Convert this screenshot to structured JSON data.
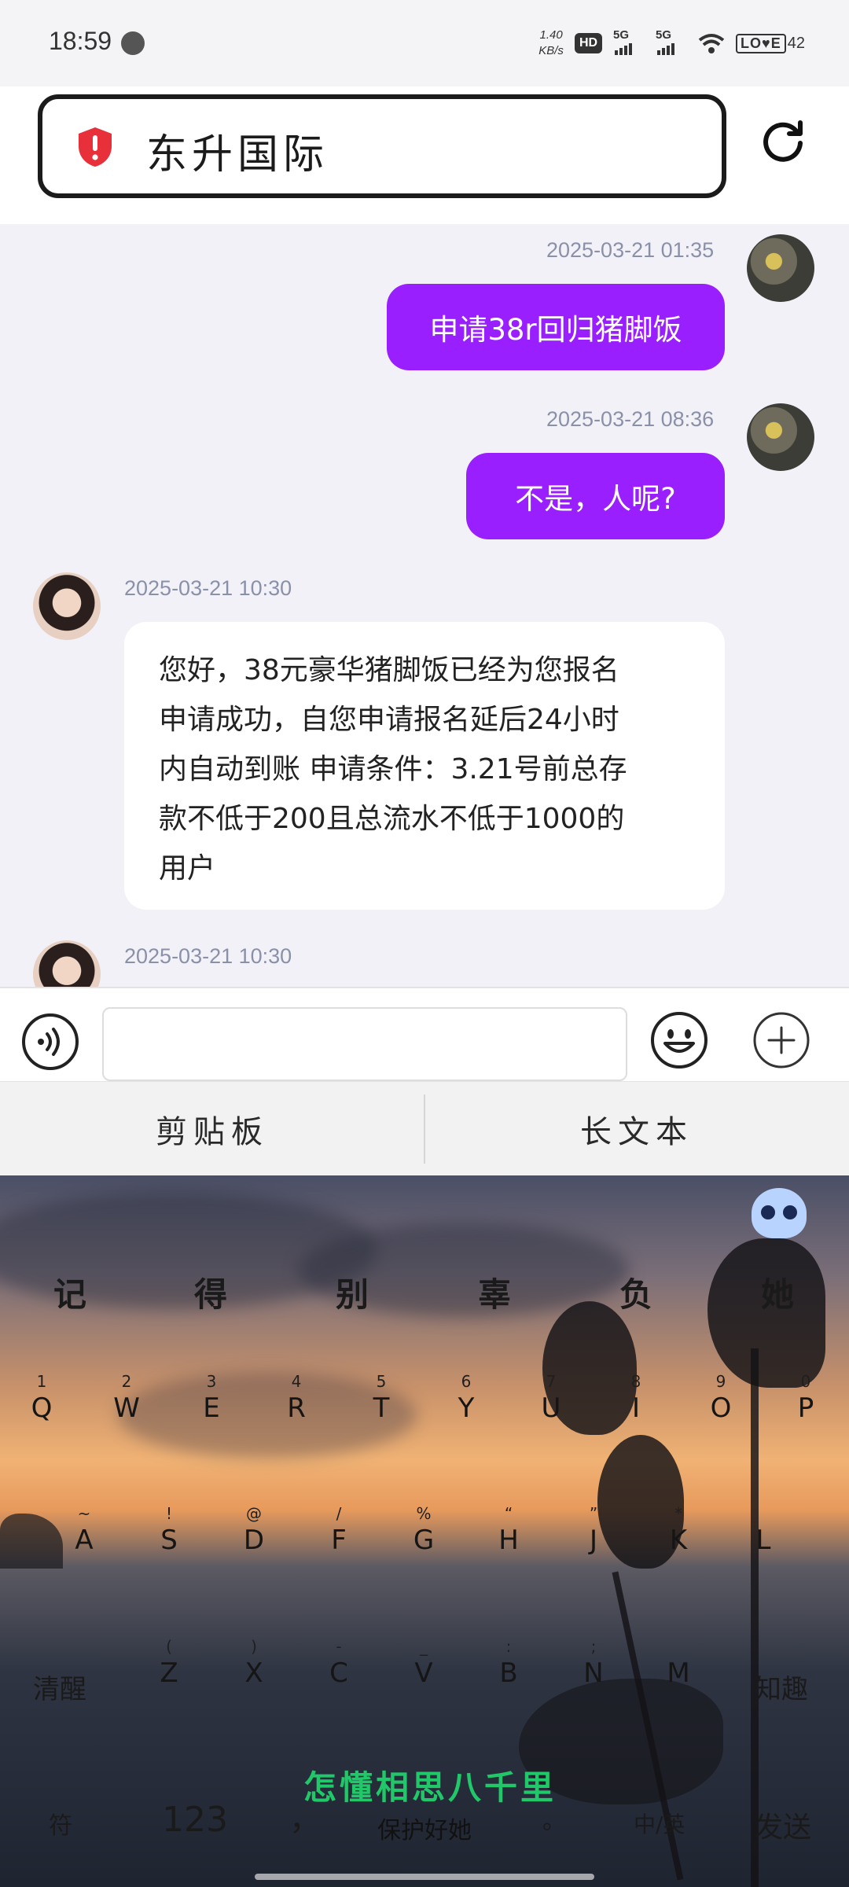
{
  "status_bar": {
    "time": "18:59",
    "net_speed_value": "1.40",
    "net_speed_unit": "KB/s",
    "hd_label": "HD",
    "sim1_label": "5G",
    "sim2_label": "5G",
    "battery_label": "LO♥E",
    "battery_level": "42"
  },
  "header": {
    "title": "东升国际",
    "shield_color": "#e8303a"
  },
  "messages": [
    {
      "sender": "self",
      "timestamp": "2025-03-21 01:35",
      "text": "申请38r回归猪脚饭"
    },
    {
      "sender": "self",
      "timestamp": "2025-03-21 08:36",
      "text": "不是，人呢?"
    },
    {
      "sender": "agent",
      "timestamp": "2025-03-21 10:30",
      "lines": [
        "您好，38元豪华猪脚饭已经为您报名",
        "申请成功，自您申请报名延后24小时",
        "内自动到账 申请条件：3.21号前总存",
        "款不低于200且总流水不低于1000的",
        "用户"
      ]
    },
    {
      "sender": "agent",
      "timestamp": "2025-03-21 10:30"
    }
  ],
  "input_bar": {
    "placeholder": ""
  },
  "keyboard_toolbar": {
    "clipboard": "剪贴板",
    "long_text": "长文本"
  },
  "keyboard": {
    "candidates": [
      "记",
      "得",
      "别",
      "辜",
      "负",
      "她"
    ],
    "row1": [
      {
        "top": "1",
        "main": "Q"
      },
      {
        "top": "2",
        "main": "W"
      },
      {
        "top": "3",
        "main": "E"
      },
      {
        "top": "4",
        "main": "R"
      },
      {
        "top": "5",
        "main": "T"
      },
      {
        "top": "6",
        "main": "Y"
      },
      {
        "top": "7",
        "main": "U"
      },
      {
        "top": "8",
        "main": "I"
      },
      {
        "top": "9",
        "main": "O"
      },
      {
        "top": "0",
        "main": "P"
      }
    ],
    "row2": [
      {
        "top": "~",
        "main": "A"
      },
      {
        "top": "!",
        "main": "S"
      },
      {
        "top": "@",
        "main": "D"
      },
      {
        "top": "/",
        "main": "F"
      },
      {
        "top": "%",
        "main": "G"
      },
      {
        "top": "“",
        "main": "H"
      },
      {
        "top": "”",
        "main": "J"
      },
      {
        "top": "*",
        "main": "K"
      },
      {
        "top": "",
        "main": "L"
      }
    ],
    "row3": [
      {
        "top": "(",
        "main": "Z"
      },
      {
        "top": ")",
        "main": "X"
      },
      {
        "top": "-",
        "main": "C"
      },
      {
        "top": "_",
        "main": "V"
      },
      {
        "top": ":",
        "main": "B"
      },
      {
        "top": ";",
        "main": "N"
      },
      {
        "top": "",
        "main": "M"
      }
    ],
    "left_fn": "清醒",
    "right_fn": "知趣",
    "symbol_key": "符",
    "number_key": "123",
    "comma_key": "，",
    "space_label": "保护好她",
    "period_key": "。",
    "lang_key": "中/英",
    "send_key": "发送",
    "lyric": "怎懂相思八千里"
  },
  "colors": {
    "accent": "#9a1fff",
    "chat_bg": "#f1f1f7",
    "timestamp": "#8a90a8"
  }
}
